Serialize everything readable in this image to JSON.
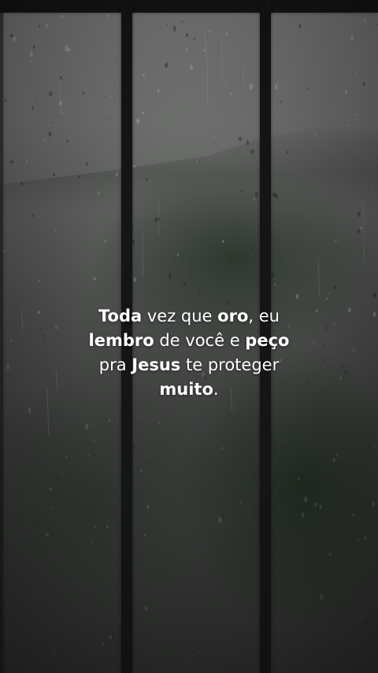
{
  "background": {
    "description_icon": "rainy-window-photo",
    "frame_color": "#141514"
  },
  "caption": {
    "lines": [
      [
        {
          "text": "Toda",
          "bold": true
        },
        {
          "text": " vez que ",
          "bold": false
        },
        {
          "text": "oro",
          "bold": true
        },
        {
          "text": ", eu",
          "bold": false
        }
      ],
      [
        {
          "text": "lembro",
          "bold": true
        },
        {
          "text": " de você e ",
          "bold": false
        },
        {
          "text": "peço",
          "bold": true
        }
      ],
      [
        {
          "text": "pra ",
          "bold": false
        },
        {
          "text": "Jesus",
          "bold": true
        },
        {
          "text": " te proteger",
          "bold": false
        }
      ],
      [
        {
          "text": "muito",
          "bold": true
        },
        {
          "text": ".",
          "bold": false
        }
      ]
    ]
  }
}
